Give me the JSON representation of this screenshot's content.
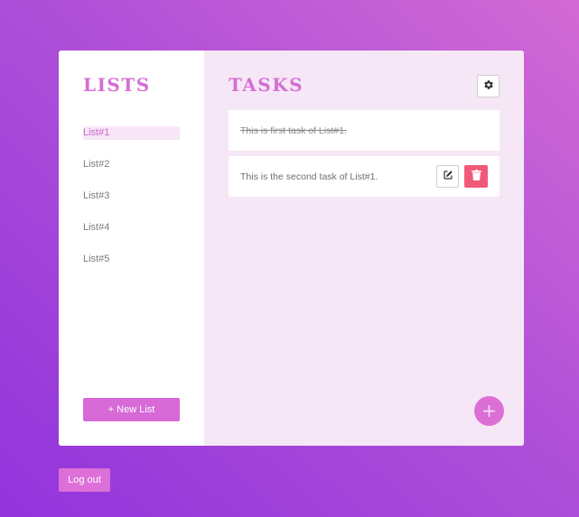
{
  "sidebar": {
    "title": "LISTS",
    "items": [
      {
        "label": "List#1",
        "active": true
      },
      {
        "label": "List#2",
        "active": false
      },
      {
        "label": "List#3",
        "active": false
      },
      {
        "label": "List#4",
        "active": false
      },
      {
        "label": "List#5",
        "active": false
      }
    ],
    "new_list_label": "+ New List"
  },
  "tasks": {
    "title": "TASKS",
    "settings_icon": "gear-icon",
    "items": [
      {
        "text": "This is first task of List#1.",
        "completed": true
      },
      {
        "text": "This is the second task of List#1.",
        "completed": false,
        "edit_icon": "edit-icon",
        "delete_icon": "trash-icon"
      }
    ],
    "add_label": "+"
  },
  "footer": {
    "logout_label": "Log out"
  },
  "colors": {
    "accent": "#d56fd4",
    "delete": "#f05a78",
    "panel_bg": "#f6e7f6",
    "bg_start": "#9134dc",
    "bg_end": "#d26ad4"
  }
}
